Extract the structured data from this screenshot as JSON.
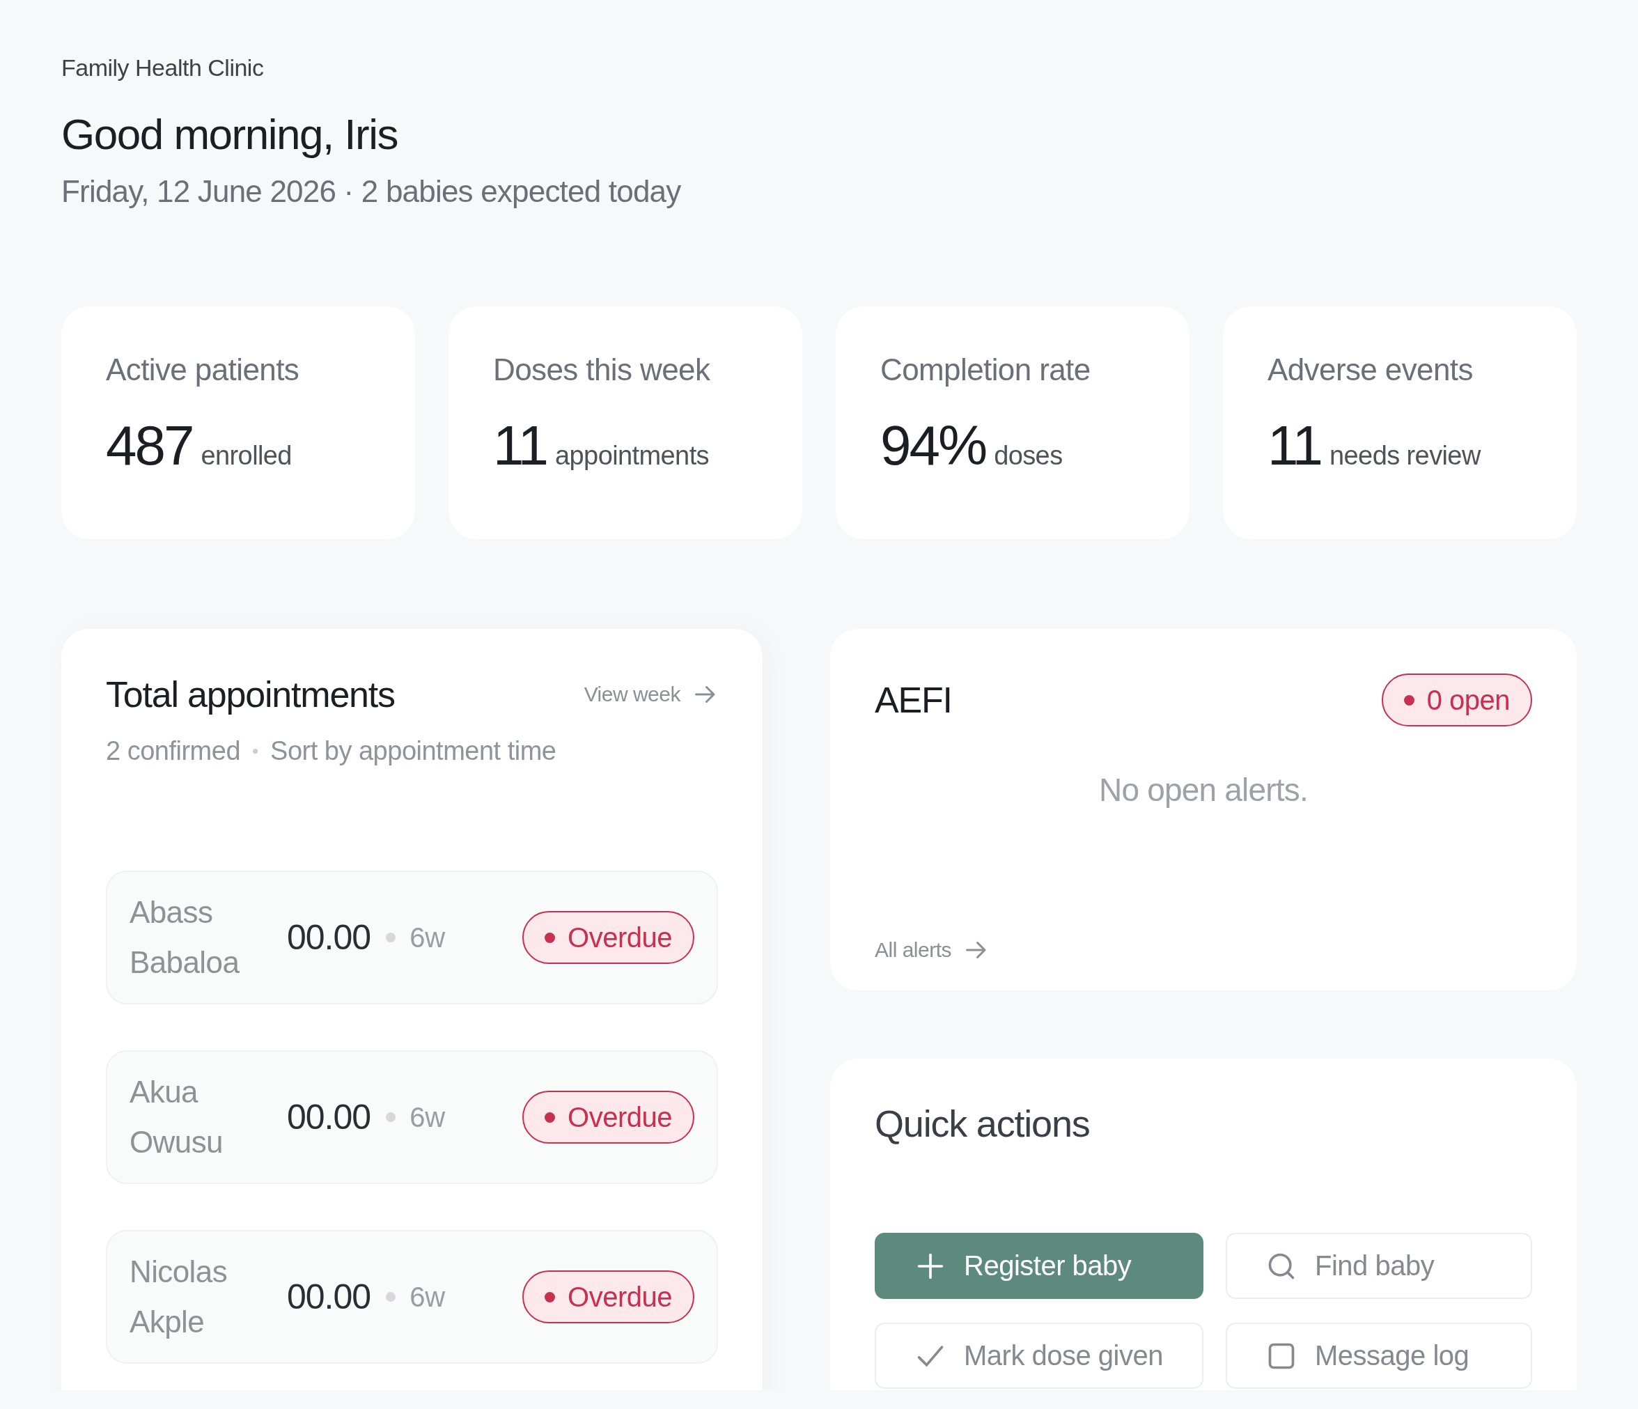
{
  "header": {
    "clinic": "Family Health Clinic",
    "greeting": "Good morning, Iris",
    "subtitle": "Friday, 12 June 2026 · 2 babies expected today"
  },
  "stats": [
    {
      "label": "Active patients",
      "value": "487",
      "unit": "enrolled"
    },
    {
      "label": "Doses this week",
      "value": "11",
      "unit": "appointments"
    },
    {
      "label": "Completion rate",
      "value": "94%",
      "unit": "doses"
    },
    {
      "label": "Adverse events",
      "value": "11",
      "unit": "needs review"
    }
  ],
  "appointments": {
    "title": "Total appointments",
    "link": "View week",
    "confirmed": "2 confirmed",
    "sort": "Sort by appointment time",
    "rows": [
      {
        "name": "Abass Babaloa",
        "time": "00.00",
        "age": "6w",
        "status": "Overdue"
      },
      {
        "name": "Akua Owusu",
        "time": "00.00",
        "age": "6w",
        "status": "Overdue"
      },
      {
        "name": "Nicolas Akple",
        "time": "00.00",
        "age": "6w",
        "status": "Overdue"
      }
    ]
  },
  "aefi": {
    "title": "AEFI",
    "badge": "0 open",
    "empty": "No open alerts.",
    "link": "All alerts"
  },
  "quick_actions": {
    "title": "Quick actions",
    "actions": [
      {
        "label": "Register baby",
        "kind": "primary"
      },
      {
        "label": "Find baby",
        "kind": "secondary"
      },
      {
        "label": "Mark dose given",
        "kind": "secondary"
      },
      {
        "label": "Message log",
        "kind": "secondary"
      }
    ]
  }
}
